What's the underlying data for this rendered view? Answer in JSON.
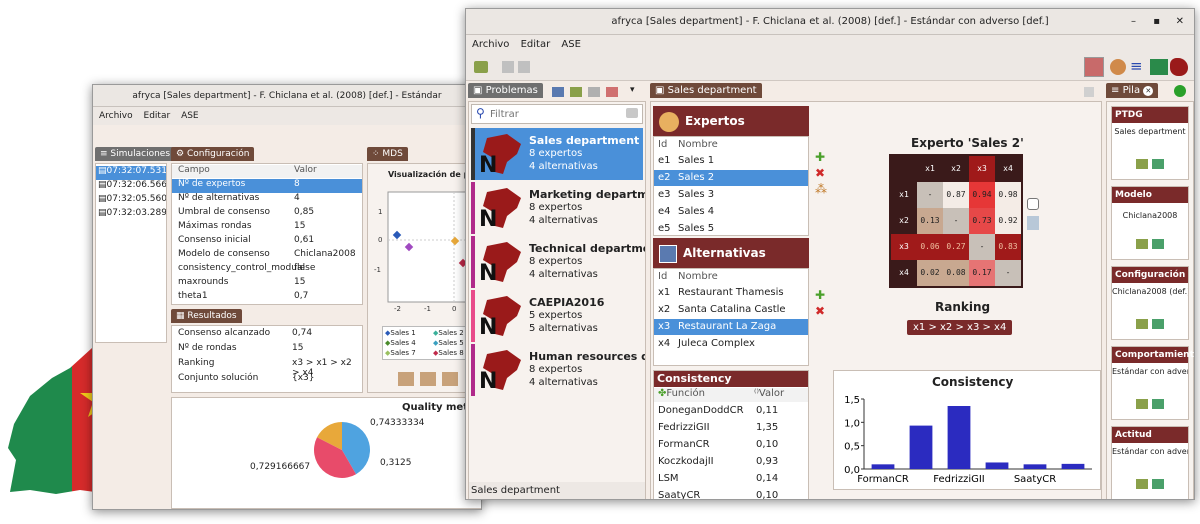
{
  "back_window": {
    "title": "afryca [Sales department] - F. Chiclana et al. (2008) [def.] - Estándar",
    "menu": [
      "Archivo",
      "Editar",
      "ASE"
    ],
    "sim_tab": "Simulaciones",
    "simulations": [
      "07:32:07.531",
      "07:32:06.566",
      "07:32:05.560",
      "07:32:03.289"
    ],
    "config_tab": "Configuración",
    "config_headers": {
      "campo": "Campo",
      "valor": "Valor"
    },
    "config_rows": [
      {
        "k": "Nº de expertos",
        "v": "8"
      },
      {
        "k": "Nº de alternativas",
        "v": "4"
      },
      {
        "k": "Umbral de consenso",
        "v": "0,85"
      },
      {
        "k": "Máximas rondas",
        "v": "15"
      },
      {
        "k": "Consenso inicial",
        "v": "0,61"
      },
      {
        "k": "Modelo de consenso",
        "v": "Chiclana2008"
      },
      {
        "k": "consistency_control_module",
        "v": "false"
      },
      {
        "k": "maxrounds",
        "v": "15"
      },
      {
        "k": "theta1",
        "v": "0,7"
      }
    ],
    "results_tab": "Resultados",
    "results_rows": [
      {
        "k": "Consenso alcanzado",
        "v": "0,74"
      },
      {
        "k": "Nº de rondas",
        "v": "15"
      },
      {
        "k": "Ranking",
        "v": "x3 > x1 > x2 > x4"
      },
      {
        "k": "Conjunto solución",
        "v": "{x3}"
      }
    ],
    "mds_tab": "MDS",
    "mds_title": "Visualización de prefer",
    "mds_yticks": [
      "1",
      "0",
      "-1"
    ],
    "mds_xticks": [
      "-2",
      "-1",
      "0"
    ],
    "mds_legend": [
      "Sales 1",
      "Sales 2",
      "Sales 4",
      "Sales 5",
      "Sales 7",
      "Sales 8"
    ],
    "quality_title": "Quality metric",
    "pie_labels": [
      "0,74333334",
      "0,729166667",
      "0,3125"
    ],
    "pie_data": [
      0.74333334,
      0.729166667,
      0.3125
    ],
    "pie_colors": [
      "#4fa3e0",
      "#e84b6a",
      "#e8a83a"
    ]
  },
  "front_window": {
    "title": "afryca [Sales department] - F. Chiclana et al. (2008) [def.] - Estándar con adverso [def.]",
    "menu": [
      "Archivo",
      "Editar",
      "ASE"
    ],
    "window_controls": [
      "–",
      "▪",
      "✕"
    ],
    "problems_tab": "Problemas",
    "filter_placeholder": "Filtrar",
    "problems": [
      {
        "name": "Sales department",
        "l1": "8 expertos",
        "l2": "4 alternativas",
        "color": "#e8aac0"
      },
      {
        "name": "Marketing department",
        "l1": "8 expertos",
        "l2": "4 alternativas",
        "color": "#b02a8a"
      },
      {
        "name": "Technical department",
        "l1": "8 expertos",
        "l2": "4 alternativas",
        "color": "#b02a8a"
      },
      {
        "name": "CAEPIA2016",
        "l1": "5 expertos",
        "l2": "5 alternativas",
        "color": "#e84b8a"
      },
      {
        "name": "Human resources depart",
        "l1": "8 expertos",
        "l2": "4 alternativas",
        "color": "#b02a8a"
      }
    ],
    "status": "Sales department",
    "sales_tab": "Sales department",
    "experts_title": "Expertos",
    "id_header": "Id",
    "name_header": "Nombre",
    "experts": [
      {
        "id": "e1",
        "name": "Sales 1"
      },
      {
        "id": "e2",
        "name": "Sales 2"
      },
      {
        "id": "e3",
        "name": "Sales 3"
      },
      {
        "id": "e4",
        "name": "Sales 4"
      },
      {
        "id": "e5",
        "name": "Sales 5"
      }
    ],
    "alternatives_title": "Alternativas",
    "alternatives": [
      {
        "id": "x1",
        "name": "Restaurant Thamesis"
      },
      {
        "id": "x2",
        "name": "Santa Catalina Castle"
      },
      {
        "id": "x3",
        "name": "Restaurant La Zaga"
      },
      {
        "id": "x4",
        "name": "Juleca Complex"
      }
    ],
    "consistency_title": "Consistency",
    "consistency_headers": {
      "func": "Función",
      "val": "Valor"
    },
    "consistency_rows": [
      {
        "k": "DoneganDoddCR",
        "v": "0,11"
      },
      {
        "k": "FedrizziGII",
        "v": "1,35"
      },
      {
        "k": "FormanCR",
        "v": "0,10"
      },
      {
        "k": "KoczkodajII",
        "v": "0,93"
      },
      {
        "k": "LSM",
        "v": "0,14"
      },
      {
        "k": "SaatyCR",
        "v": "0,10"
      }
    ],
    "expert_title": "Experto 'Sales 2'",
    "matrix_headers": [
      "x1",
      "x2",
      "x3",
      "x4"
    ],
    "matrix": [
      [
        "-",
        "0.87",
        "0.94",
        "0.98"
      ],
      [
        "0.13",
        "-",
        "0.73",
        "0.92"
      ],
      [
        "0.06",
        "0.27",
        "-",
        "0.83"
      ],
      [
        "0.02",
        "0.08",
        "0.17",
        "-"
      ]
    ],
    "ranking_title": "Ranking",
    "ranking": "x1 > x2 > x3 > x4",
    "chart_title": "Consistency",
    "pila_tab": "Pila",
    "stack": [
      {
        "title": "PTDG",
        "text": "Sales department"
      },
      {
        "title": "Modelo",
        "text": "Chiclana2008"
      },
      {
        "title": "Configuración",
        "text": "Chiclana2008 (def.)"
      },
      {
        "title": "Comportamiento",
        "text": "Estándar con adverso"
      },
      {
        "title": "Actitud",
        "text": "Estándar con adverso"
      }
    ]
  },
  "chart_data": {
    "type": "bar",
    "title": "Consistency",
    "categories": [
      "FormanCR",
      "",
      "FedrizziGII",
      "",
      "SaatyCR",
      ""
    ],
    "values": [
      0.1,
      0.93,
      1.35,
      0.14,
      0.1,
      0.11
    ],
    "ylim": [
      0,
      1.5
    ],
    "yticks": [
      "0,0",
      "0,5",
      "1,0",
      "1,5"
    ],
    "bar_color": "#2b2bc0"
  }
}
